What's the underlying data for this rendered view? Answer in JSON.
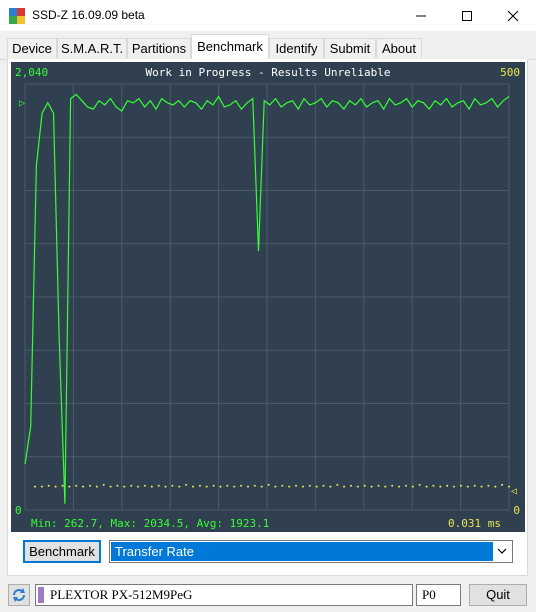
{
  "window": {
    "title": "SSD-Z 16.09.09 beta"
  },
  "tabs": [
    {
      "label": "Device"
    },
    {
      "label": "S.M.A.R.T."
    },
    {
      "label": "Partitions"
    },
    {
      "label": "Benchmark"
    },
    {
      "label": "Identify"
    },
    {
      "label": "Submit"
    },
    {
      "label": "About"
    }
  ],
  "chart": {
    "title": "Work in Progress - Results Unreliable",
    "y_left_top": "2,040",
    "y_left_bottom": "0",
    "y_right_top": "500",
    "y_right_bottom": "0",
    "stats": "Min: 262.7, Max: 2034.5, Avg: 1923.1",
    "latency": "0.031 ms",
    "colors": {
      "background": "#314050",
      "grid": "#4a5a6a",
      "transfer": "#33ff33",
      "latency": "#e6e64d",
      "text_green": "#33ff33",
      "text_white": "#ffffff",
      "text_yellow": "#e6e64d"
    }
  },
  "chart_data": {
    "type": "line",
    "title": "Work in Progress - Results Unreliable",
    "ylim": [
      0,
      2040
    ],
    "y2lim": [
      0,
      500
    ],
    "series": [
      {
        "axis": "left",
        "values": [
          220,
          400,
          1650,
          1900,
          1950,
          1900,
          820,
          30,
          1970,
          1990,
          1960,
          1930,
          1920,
          1960,
          1940,
          1970,
          1930,
          1910,
          1960,
          1950,
          1970,
          1930,
          1960,
          1920,
          1970,
          1950,
          1940,
          1960,
          1930,
          1960,
          1950,
          1920,
          1960,
          1940,
          1980,
          1930,
          1940,
          1960,
          1920,
          1950,
          1970,
          1240,
          1960,
          1940,
          1970,
          1930,
          1950,
          1960,
          1920,
          1970,
          1940,
          1950,
          1970,
          1930,
          1960,
          1950,
          1920,
          1960,
          1940,
          1970,
          1930,
          1950,
          1960,
          1920,
          1970,
          1940,
          1950,
          1970,
          1930,
          1960,
          1950,
          1920,
          1960,
          1940,
          1970,
          1930,
          1950,
          1960,
          1920,
          1970,
          1940,
          1950,
          1970,
          1930,
          1960,
          1980
        ]
      },
      {
        "axis": "right",
        "values": [
          4,
          4,
          5,
          4,
          5,
          4,
          5,
          4,
          5,
          4,
          6,
          4,
          5,
          4,
          5,
          4,
          5,
          4,
          5,
          4,
          5,
          4,
          6,
          4,
          5,
          4,
          5,
          4,
          5,
          4,
          5,
          4,
          5,
          4,
          6,
          4,
          5,
          4,
          5,
          4,
          5,
          4,
          5,
          4,
          6,
          4,
          5,
          4,
          5,
          4,
          5,
          4,
          5,
          4,
          5,
          4,
          6,
          4,
          5,
          4,
          5,
          4,
          5,
          4,
          5,
          4,
          5,
          4,
          6,
          4
        ]
      }
    ]
  },
  "controls": {
    "benchmark_button": "Benchmark",
    "mode_selected": "Transfer Rate"
  },
  "status": {
    "drive": "PLEXTOR PX-512M9PeG",
    "partition": "P0",
    "quit_button": "Quit"
  }
}
